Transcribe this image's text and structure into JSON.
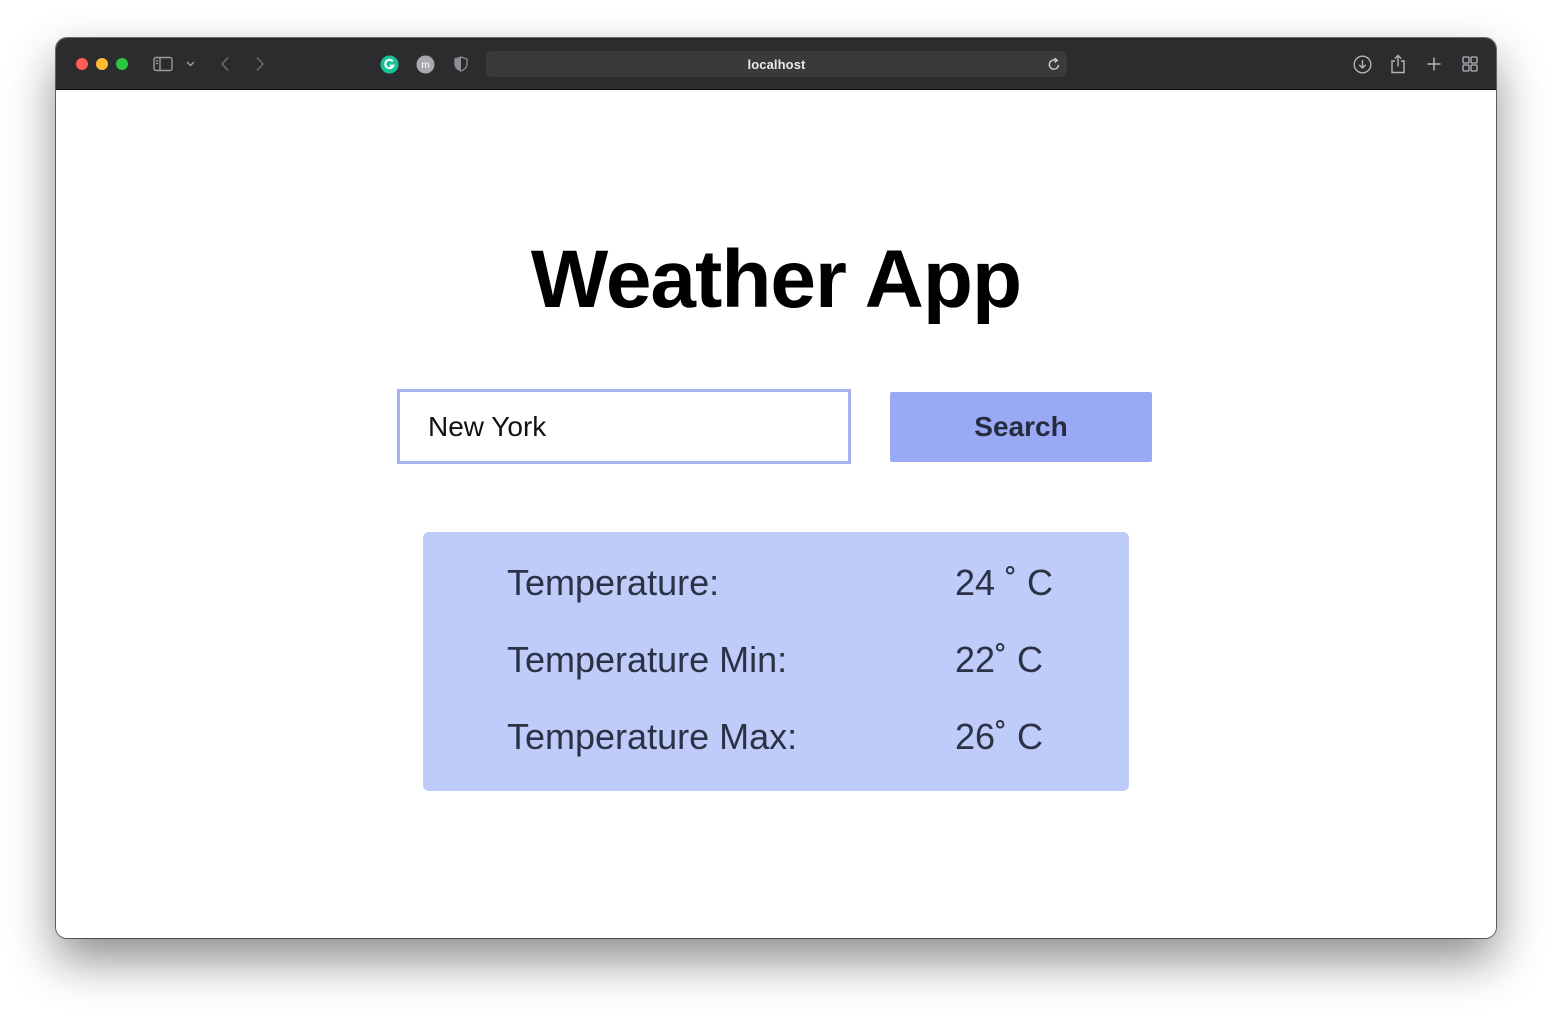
{
  "browser": {
    "url": "localhost",
    "icons": [
      "sidebar-icon",
      "chevron-down-icon",
      "back-icon",
      "forward-icon",
      "grammarly-icon",
      "extension-m-icon",
      "shield-icon",
      "reload-icon",
      "download-icon",
      "share-icon",
      "new-tab-icon",
      "tab-overview-icon"
    ],
    "extension_letter": "m"
  },
  "app": {
    "title": "Weather App",
    "search": {
      "value": "New York",
      "button_label": "Search"
    },
    "results": [
      {
        "label": "Temperature:",
        "value": "24 ˚ C"
      },
      {
        "label": "Temperature Min:",
        "value": "22˚ C"
      },
      {
        "label": "Temperature Max:",
        "value": "26˚ C"
      }
    ]
  },
  "colors": {
    "toolbar": "#2c2c2e",
    "input_border": "#a7b2ef",
    "button_bg": "#99a9f6",
    "results_bg": "#bfcbf9",
    "text_dark": "#2b3246"
  }
}
